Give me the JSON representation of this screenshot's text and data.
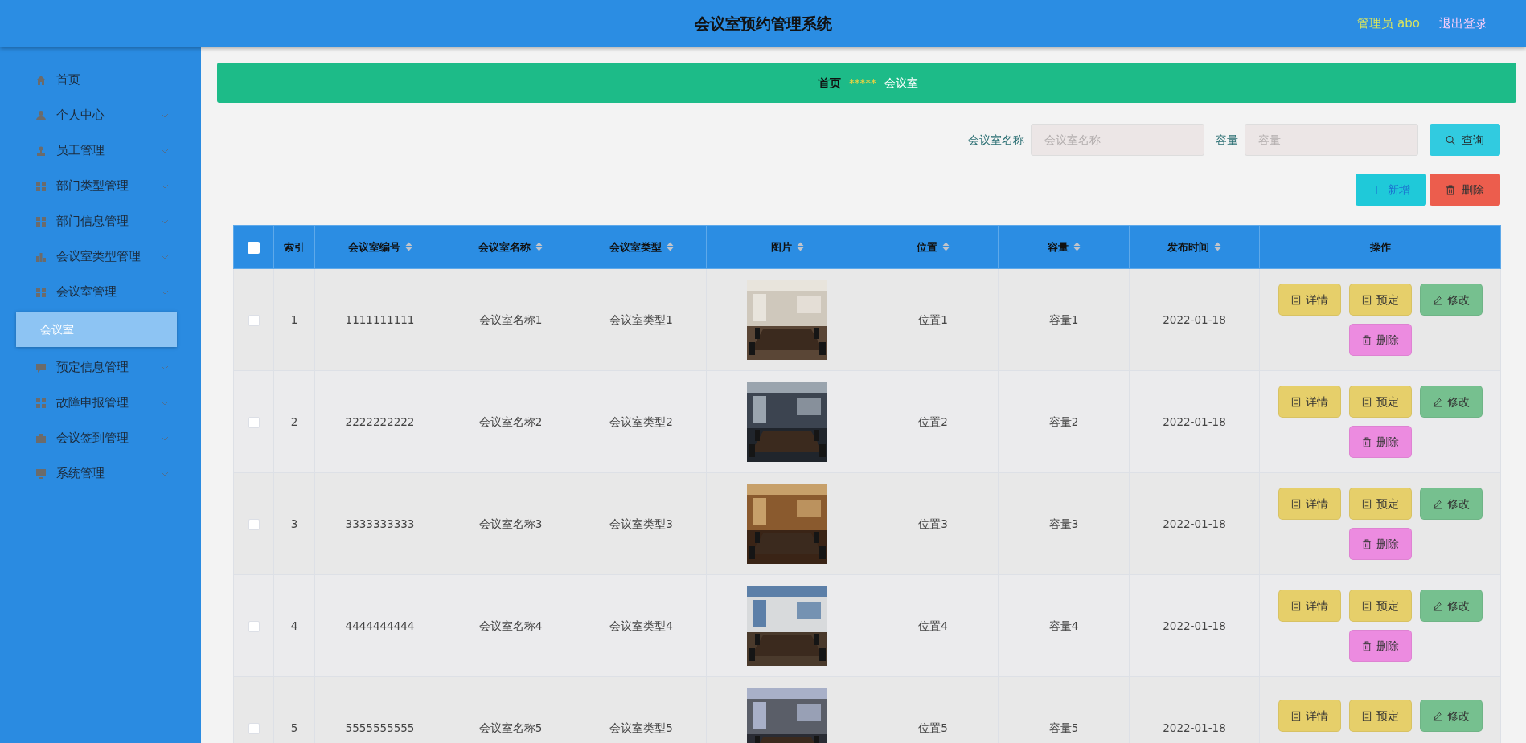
{
  "header": {
    "title": "会议室预约管理系统",
    "user": "管理员 abo",
    "logout": "退出登录"
  },
  "sidebar": {
    "items": [
      {
        "label": "首页",
        "kind": "link"
      },
      {
        "label": "个人中心",
        "kind": "menu"
      },
      {
        "label": "员工管理",
        "kind": "menu"
      },
      {
        "label": "部门类型管理",
        "kind": "menu"
      },
      {
        "label": "部门信息管理",
        "kind": "menu"
      },
      {
        "label": "会议室类型管理",
        "kind": "menu"
      },
      {
        "label": "会议室管理",
        "kind": "menu",
        "children": [
          {
            "label": "会议室",
            "selected": true
          }
        ]
      },
      {
        "label": "预定信息管理",
        "kind": "menu"
      },
      {
        "label": "故障申报管理",
        "kind": "menu"
      },
      {
        "label": "会议签到管理",
        "kind": "menu"
      },
      {
        "label": "系统管理",
        "kind": "menu"
      }
    ]
  },
  "breadcrumb": {
    "items": [
      "首页",
      "会议室"
    ],
    "separator": "*****"
  },
  "search": {
    "fields": [
      {
        "label": "会议室名称",
        "placeholder": "会议室名称"
      },
      {
        "label": "容量",
        "placeholder": "容量"
      }
    ],
    "button": "查询"
  },
  "toolbar": {
    "buttons": [
      {
        "label": "新增",
        "kind": "add"
      },
      {
        "label": "删除",
        "kind": "delete"
      }
    ]
  },
  "table": {
    "select_all_checked": false,
    "columns": [
      {
        "label": "索引",
        "sortable": false
      },
      {
        "label": "会议室编号",
        "sortable": true
      },
      {
        "label": "会议室名称",
        "sortable": true
      },
      {
        "label": "会议室类型",
        "sortable": true
      },
      {
        "label": "图片",
        "sortable": true
      },
      {
        "label": "位置",
        "sortable": true
      },
      {
        "label": "容量",
        "sortable": true
      },
      {
        "label": "发布时间",
        "sortable": true
      },
      {
        "label": "操作",
        "sortable": false
      }
    ],
    "rows": [
      {
        "checked": false,
        "cells": [
          "1",
          "1111111111",
          "会议室名称1",
          "会议室类型1",
          {
            "kind": "picture"
          },
          "位置1",
          "容量1",
          "2022-01-18"
        ],
        "actions": [
          {
            "label": "详情",
            "kind": "detail"
          },
          {
            "label": "预定",
            "kind": "book"
          },
          {
            "label": "修改",
            "kind": "edit"
          },
          {
            "label": "删除",
            "kind": "delete"
          }
        ]
      },
      {
        "checked": false,
        "cells": [
          "2",
          "2222222222",
          "会议室名称2",
          "会议室类型2",
          {
            "kind": "picture"
          },
          "位置2",
          "容量2",
          "2022-01-18"
        ],
        "actions": [
          {
            "label": "详情",
            "kind": "detail"
          },
          {
            "label": "预定",
            "kind": "book"
          },
          {
            "label": "修改",
            "kind": "edit"
          },
          {
            "label": "删除",
            "kind": "delete"
          }
        ]
      },
      {
        "checked": false,
        "cells": [
          "3",
          "3333333333",
          "会议室名称3",
          "会议室类型3",
          {
            "kind": "picture"
          },
          "位置3",
          "容量3",
          "2022-01-18"
        ],
        "actions": [
          {
            "label": "详情",
            "kind": "detail"
          },
          {
            "label": "预定",
            "kind": "book"
          },
          {
            "label": "修改",
            "kind": "edit"
          },
          {
            "label": "删除",
            "kind": "delete"
          }
        ]
      },
      {
        "checked": false,
        "cells": [
          "4",
          "4444444444",
          "会议室名称4",
          "会议室类型4",
          {
            "kind": "picture"
          },
          "位置4",
          "容量4",
          "2022-01-18"
        ],
        "actions": [
          {
            "label": "详情",
            "kind": "detail"
          },
          {
            "label": "预定",
            "kind": "book"
          },
          {
            "label": "修改",
            "kind": "edit"
          },
          {
            "label": "删除",
            "kind": "delete"
          }
        ]
      },
      {
        "checked": false,
        "cells": [
          "5",
          "5555555555",
          "会议室名称5",
          "会议室类型5",
          {
            "kind": "picture"
          },
          "位置5",
          "容量5",
          "2022-01-18"
        ],
        "actions": [
          {
            "label": "详情",
            "kind": "detail"
          },
          {
            "label": "预定",
            "kind": "book"
          },
          {
            "label": "修改",
            "kind": "edit"
          }
        ]
      }
    ]
  }
}
